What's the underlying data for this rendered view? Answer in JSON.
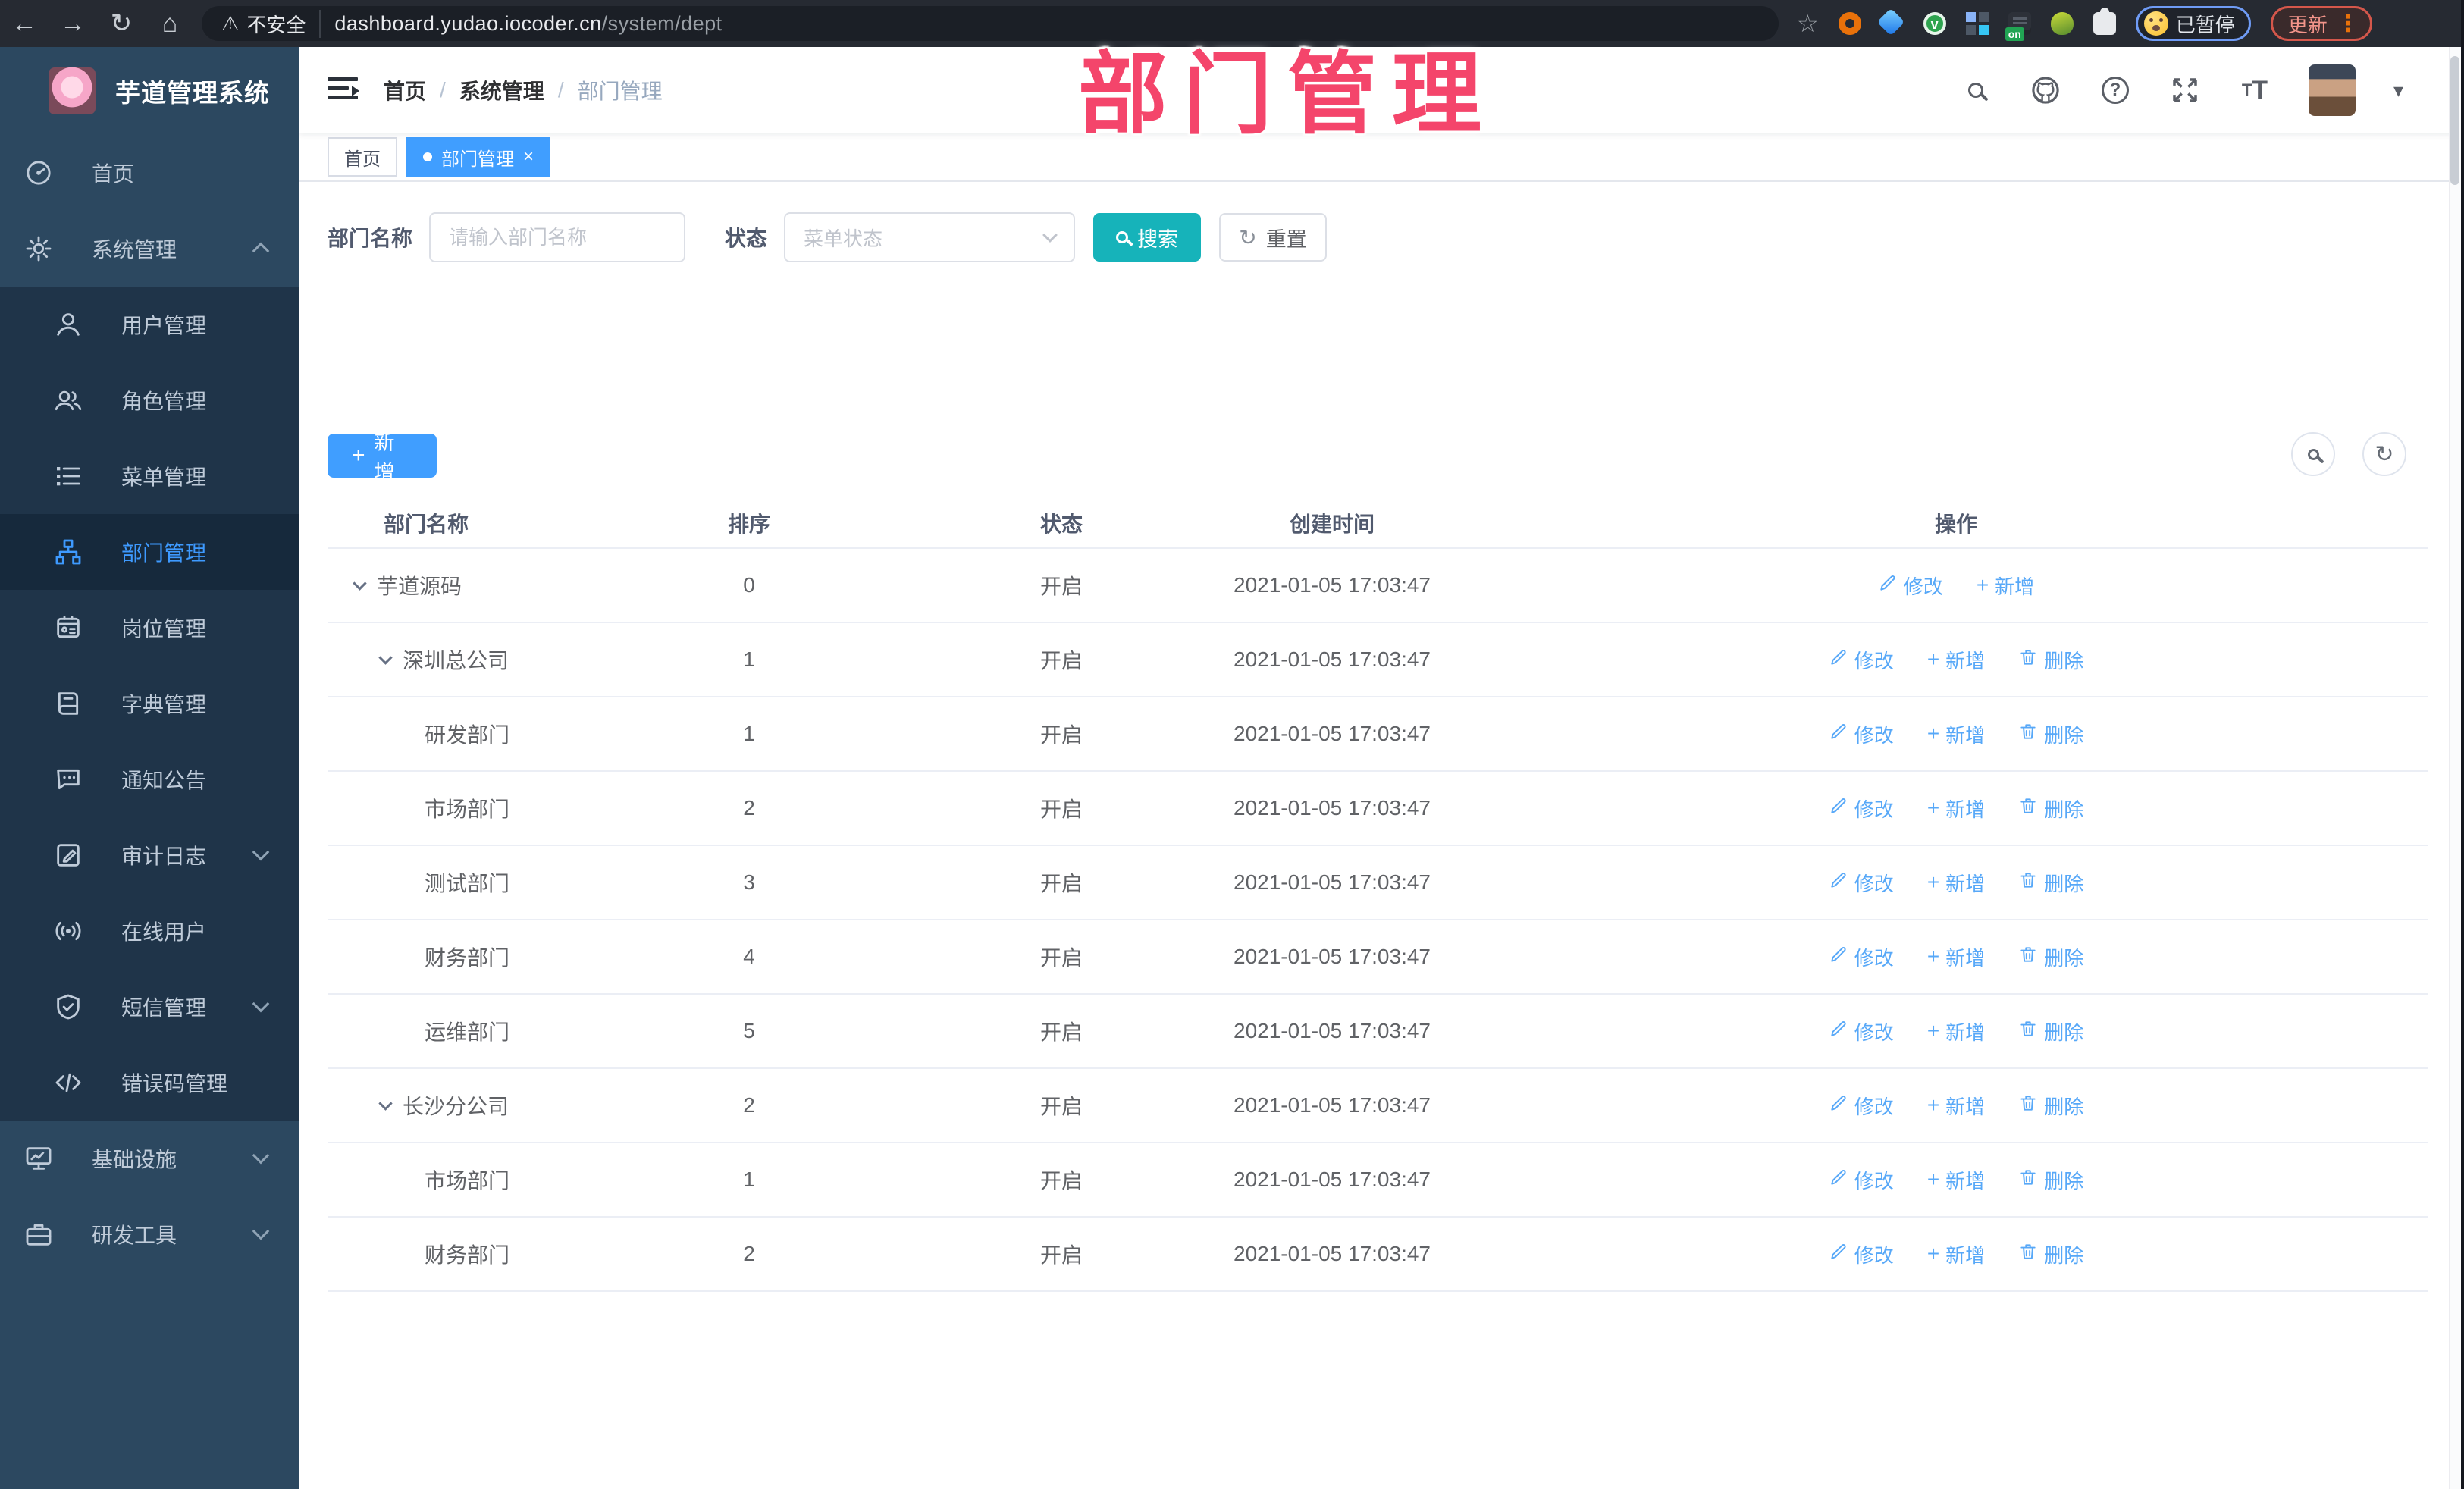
{
  "browser": {
    "security_label": "不安全",
    "url_host": "dashboard.yudao.iocoder.cn",
    "url_path": "/system/dept",
    "profile_badge": "已暂停",
    "update_label": "更新",
    "extension_on_badge": "on"
  },
  "sidebar": {
    "app_title": "芋道管理系统",
    "menu": [
      {
        "label": "首页",
        "icon": "dashboard-icon",
        "level": 0
      },
      {
        "label": "系统管理",
        "icon": "gear-icon",
        "level": 0,
        "arrow": "up"
      },
      {
        "label": "用户管理",
        "icon": "user-icon",
        "level": 1
      },
      {
        "label": "角色管理",
        "icon": "users-icon",
        "level": 1
      },
      {
        "label": "菜单管理",
        "icon": "menu-list-icon",
        "level": 1
      },
      {
        "label": "部门管理",
        "icon": "org-tree-icon",
        "level": 1,
        "active": true
      },
      {
        "label": "岗位管理",
        "icon": "badge-icon",
        "level": 1
      },
      {
        "label": "字典管理",
        "icon": "dict-icon",
        "level": 1
      },
      {
        "label": "通知公告",
        "icon": "notice-icon",
        "level": 1
      },
      {
        "label": "审计日志",
        "icon": "audit-icon",
        "level": 1,
        "arrow": "down"
      },
      {
        "label": "在线用户",
        "icon": "online-user-icon",
        "level": 1
      },
      {
        "label": "短信管理",
        "icon": "sms-icon",
        "level": 1,
        "arrow": "down"
      },
      {
        "label": "错误码管理",
        "icon": "code-icon",
        "level": 1
      },
      {
        "label": "基础设施",
        "icon": "infra-icon",
        "level": 0,
        "arrow": "down"
      },
      {
        "label": "研发工具",
        "icon": "devtool-icon",
        "level": 0,
        "arrow": "down"
      }
    ]
  },
  "header": {
    "breadcrumb": [
      "首页",
      "系统管理",
      "部门管理"
    ],
    "tabs": [
      {
        "label": "首页",
        "active": false
      },
      {
        "label": "部门管理",
        "active": true,
        "closable": true
      }
    ]
  },
  "annotation": {
    "text": "部门管理",
    "color": "#f4456b"
  },
  "filters": {
    "dept_name_label": "部门名称",
    "dept_name_placeholder": "请输入部门名称",
    "status_label": "状态",
    "status_placeholder": "菜单状态",
    "search_label": "搜索",
    "reset_label": "重置"
  },
  "toolbar": {
    "add_label": "新增"
  },
  "table": {
    "columns": [
      "部门名称",
      "排序",
      "状态",
      "创建时间",
      "操作"
    ],
    "rows": [
      {
        "name": "芋道源码",
        "level": 0,
        "expandable": true,
        "order": "0",
        "status": "开启",
        "created": "2021-01-05 17:03:47",
        "actions": [
          "修改",
          "新增"
        ]
      },
      {
        "name": "深圳总公司",
        "level": 1,
        "expandable": true,
        "order": "1",
        "status": "开启",
        "created": "2021-01-05 17:03:47",
        "actions": [
          "修改",
          "新增",
          "删除"
        ]
      },
      {
        "name": "研发部门",
        "level": 2,
        "expandable": false,
        "order": "1",
        "status": "开启",
        "created": "2021-01-05 17:03:47",
        "actions": [
          "修改",
          "新增",
          "删除"
        ]
      },
      {
        "name": "市场部门",
        "level": 2,
        "expandable": false,
        "order": "2",
        "status": "开启",
        "created": "2021-01-05 17:03:47",
        "actions": [
          "修改",
          "新增",
          "删除"
        ]
      },
      {
        "name": "测试部门",
        "level": 2,
        "expandable": false,
        "order": "3",
        "status": "开启",
        "created": "2021-01-05 17:03:47",
        "actions": [
          "修改",
          "新增",
          "删除"
        ]
      },
      {
        "name": "财务部门",
        "level": 2,
        "expandable": false,
        "order": "4",
        "status": "开启",
        "created": "2021-01-05 17:03:47",
        "actions": [
          "修改",
          "新增",
          "删除"
        ]
      },
      {
        "name": "运维部门",
        "level": 2,
        "expandable": false,
        "order": "5",
        "status": "开启",
        "created": "2021-01-05 17:03:47",
        "actions": [
          "修改",
          "新增",
          "删除"
        ]
      },
      {
        "name": "长沙分公司",
        "level": 1,
        "expandable": true,
        "order": "2",
        "status": "开启",
        "created": "2021-01-05 17:03:47",
        "actions": [
          "修改",
          "新增",
          "删除"
        ]
      },
      {
        "name": "市场部门",
        "level": 2,
        "expandable": false,
        "order": "1",
        "status": "开启",
        "created": "2021-01-05 17:03:47",
        "actions": [
          "修改",
          "新增",
          "删除"
        ]
      },
      {
        "name": "财务部门",
        "level": 2,
        "expandable": false,
        "order": "2",
        "status": "开启",
        "created": "2021-01-05 17:03:47",
        "actions": [
          "修改",
          "新增",
          "删除"
        ]
      }
    ],
    "action_icon_map": {
      "修改": "edit-icon",
      "新增": "plus-icon",
      "删除": "trash-icon"
    }
  },
  "colors": {
    "primary_blue": "#409eff",
    "search_teal": "#16b3ba",
    "link_blue": "#57a8f8",
    "sidebar_bg": "#2c4860",
    "submenu_bg": "#1f3449",
    "annotation_pink": "#f4456b"
  }
}
